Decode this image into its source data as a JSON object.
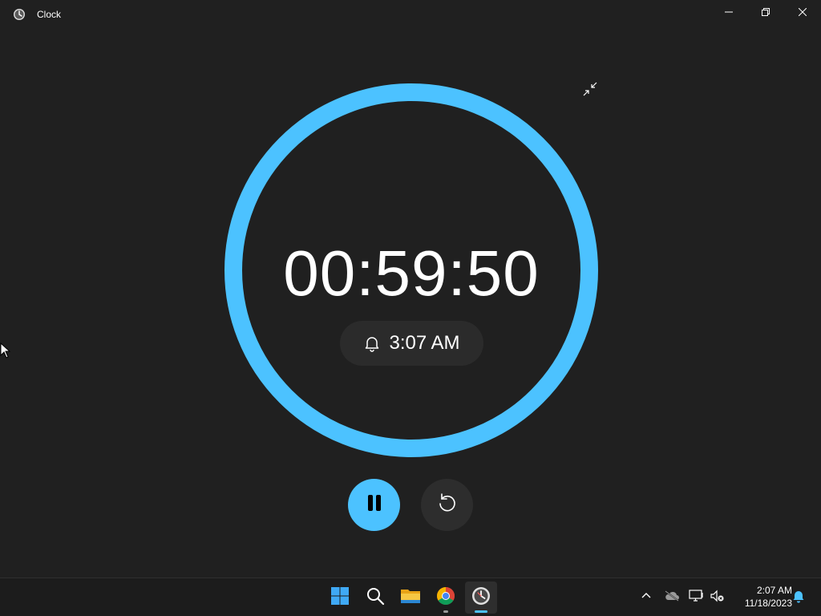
{
  "window": {
    "title": "Clock",
    "app_icon": "clock-app-icon",
    "caption_buttons": [
      "minimize-icon",
      "restore-icon",
      "close-icon"
    ]
  },
  "timer": {
    "remaining": "00:59:50",
    "alarm_time": "3:07 AM",
    "ring_progress": 1.0,
    "accent_color": "#4cc2ff"
  },
  "controls": {
    "primary": "pause-icon",
    "secondary": "reset-icon",
    "compact_overlay": "exit-compact-icon"
  },
  "taskbar": {
    "apps": [
      "windows-start-icon",
      "search-icon",
      "file-explorer-icon",
      "chrome-icon",
      "clock-app-icon"
    ],
    "tray": {
      "time": "2:07 AM",
      "date": "11/18/2023"
    }
  },
  "colors": {
    "background": "#202020",
    "accent": "#4cc2ff",
    "pill": "#2b2b2b",
    "button_secondary": "#2d2d2d"
  }
}
